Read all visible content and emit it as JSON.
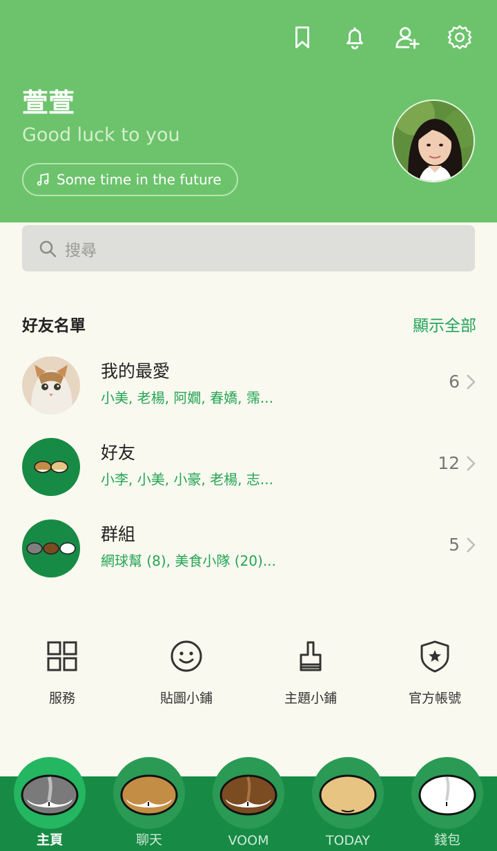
{
  "header": {
    "icons": [
      "bookmark-icon",
      "bell-icon",
      "add-friend-icon",
      "gear-icon"
    ],
    "profile": {
      "name": "萱萱",
      "status": "Good luck to you",
      "music": "Some time in the future"
    }
  },
  "search": {
    "placeholder": "搜尋"
  },
  "friends": {
    "title": "好友名單",
    "show_all": "顯示全部",
    "rows": [
      {
        "title": "我的最愛",
        "subtitle": "小美, 老楊, 阿嫺, 春嬌, 霈...",
        "count": "6"
      },
      {
        "title": "好友",
        "subtitle": "小李, 小美, 小豪, 老楊, 志...",
        "count": "12"
      },
      {
        "title": "群組",
        "subtitle": "網球幫 (8), 美食小隊 (20)...",
        "count": "5"
      }
    ]
  },
  "shortcuts": [
    {
      "label": "服務",
      "icon": "grid-icon"
    },
    {
      "label": "貼圖小鋪",
      "icon": "smiley-icon"
    },
    {
      "label": "主題小鋪",
      "icon": "brush-icon"
    },
    {
      "label": "官方帳號",
      "icon": "shield-star-icon"
    }
  ],
  "nav": [
    {
      "label": "主頁",
      "active": true
    },
    {
      "label": "聊天",
      "active": false
    },
    {
      "label": "VOOM",
      "active": false
    },
    {
      "label": "TODAY",
      "active": false
    },
    {
      "label": "錢包",
      "active": false
    }
  ],
  "colors": {
    "header": "#6cc36c",
    "accent": "#24a455",
    "nav": "#178b45",
    "background": "#f9f9ef"
  }
}
